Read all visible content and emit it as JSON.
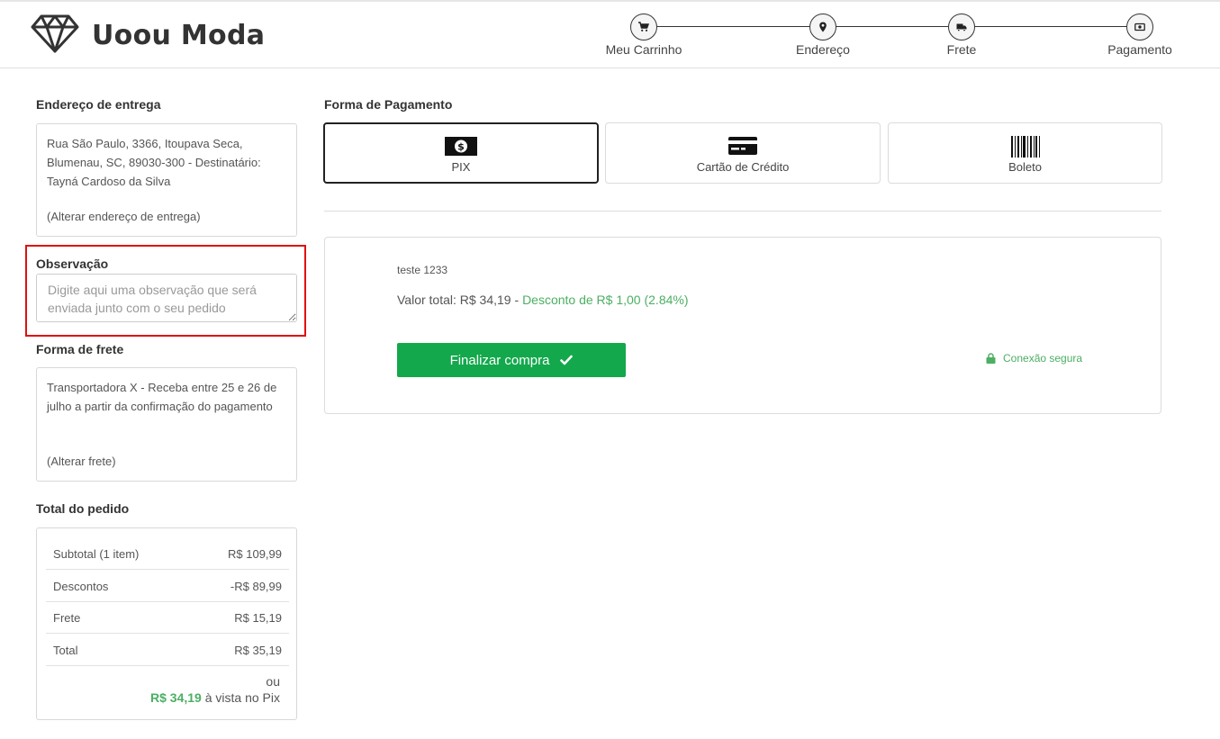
{
  "brand": {
    "name": "Uoou Moda",
    "logo_icon": "diamond-icon"
  },
  "steps": [
    {
      "label": "Meu Carrinho",
      "icon": "cart-icon"
    },
    {
      "label": "Endereço",
      "icon": "map-pin-icon"
    },
    {
      "label": "Frete",
      "icon": "truck-icon"
    },
    {
      "label": "Pagamento",
      "icon": "money-icon"
    }
  ],
  "address": {
    "title": "Endereço de entrega",
    "text": "Rua São Paulo, 3366, Itoupava Seca, Blumenau, SC, 89030-300 - Destinatário: Tayná Cardoso da Silva",
    "change_link": "(Alterar endereço de entrega)"
  },
  "observation": {
    "title": "Observação",
    "placeholder": "Digite aqui uma observação que será enviada junto com o seu pedido",
    "value": ""
  },
  "shipping": {
    "title": "Forma de frete",
    "text": "Transportadora X - Receba entre 25 e 26 de julho a partir da confirmação do pagamento",
    "change_link": "(Alterar frete)"
  },
  "totals": {
    "title": "Total do pedido",
    "rows": [
      {
        "label": "Subtotal (1 item)",
        "value": "R$ 109,99"
      },
      {
        "label": "Descontos",
        "value": "-R$ 89,99"
      },
      {
        "label": "Frete",
        "value": "R$ 15,19"
      },
      {
        "label": "Total",
        "value": "R$ 35,19"
      }
    ],
    "or_text": "ou",
    "pix_price": "R$ 34,19",
    "pix_suffix": " à vista no Pix"
  },
  "payment": {
    "title": "Forma de Pagamento",
    "options": [
      {
        "label": "PIX",
        "icon": "money-bill-icon",
        "selected": true
      },
      {
        "label": "Cartão de Crédito",
        "icon": "credit-card-icon",
        "selected": false
      },
      {
        "label": "Boleto",
        "icon": "barcode-icon",
        "selected": false
      }
    ],
    "description": "teste 1233",
    "total_label": "Valor total: R$ 34,19",
    "total_sep": " - ",
    "discount_text": "Desconto de R$ 1,00 (2.84%)",
    "finish_button": "Finalizar compra",
    "secure_text": "Conexão segura"
  },
  "colors": {
    "accent_green": "#13a84c",
    "text_green": "#4caf63",
    "highlight_red": "#e01010"
  }
}
